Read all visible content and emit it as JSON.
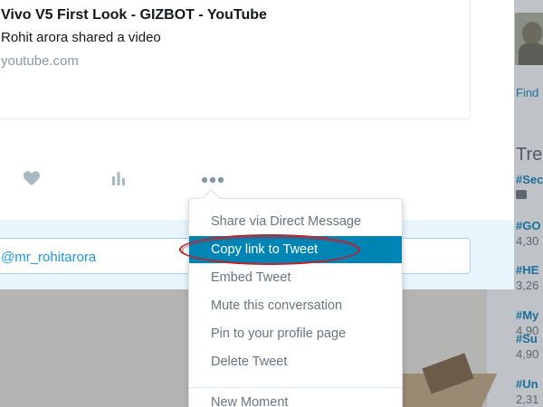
{
  "card": {
    "title": "Vivo V5 First Look - GIZBOT - YouTube",
    "subtitle": "Rohit arora shared a video",
    "url": "youtube.com"
  },
  "actions": {
    "like_icon": "heart-icon",
    "analytics_icon": "bar-chart-icon",
    "more_icon": "more-dots-icon"
  },
  "reply": {
    "text": "@mr_rohitarora"
  },
  "menu": {
    "items": [
      {
        "label": "Share via Direct Message"
      },
      {
        "label": "Copy link to Tweet",
        "active": true
      },
      {
        "label": "Embed Tweet"
      },
      {
        "label": "Mute this conversation"
      },
      {
        "label": "Pin to your profile page"
      },
      {
        "label": "Delete Tweet"
      },
      {
        "label": "New Moment"
      }
    ]
  },
  "sidebar": {
    "find_label": "Find",
    "trends_title": "Tre",
    "trends": [
      {
        "tag": "#Sec",
        "count": ""
      },
      {
        "tag": "#GO",
        "count": "4,30"
      },
      {
        "tag": "#HE",
        "count": "3,26"
      },
      {
        "tag": "#My",
        "count": "4,90"
      },
      {
        "tag": "#Su",
        "count": "4,90"
      },
      {
        "tag": "#Un",
        "count": "2,31"
      }
    ]
  },
  "colors": {
    "accent": "#0084b4",
    "link": "#1b95e0",
    "annotation": "#c0202a"
  }
}
